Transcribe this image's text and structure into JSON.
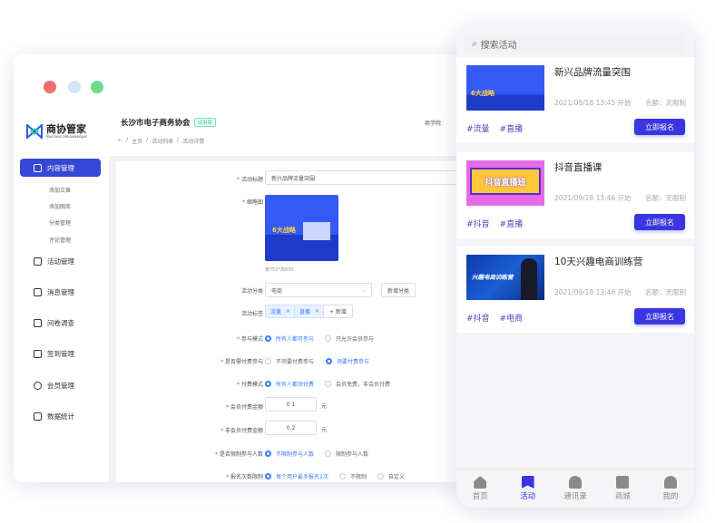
{
  "colors": {
    "accent": "#3547d6",
    "mobile_accent": "#3a36e0",
    "radio_active": "#3a7afe",
    "traffic": [
      "#f26d6d",
      "#d5e3fb",
      "#6fdc8c"
    ]
  },
  "brand": {
    "name": "商协管家",
    "subtitle": "Business Housekeeper"
  },
  "sidebar": {
    "active": {
      "label": "内容管理",
      "icon": "edit-icon"
    },
    "sub_items": [
      "添加文章",
      "添加图库",
      "分类管理",
      "评论管理"
    ],
    "items": [
      {
        "label": "活动管理",
        "icon": "flag-icon"
      },
      {
        "label": "消息管理",
        "icon": "message-icon"
      },
      {
        "label": "问卷调查",
        "icon": "book-icon"
      },
      {
        "label": "签到管理",
        "icon": "calendar-check-icon"
      },
      {
        "label": "会员管理",
        "icon": "users-icon"
      },
      {
        "label": "数据统计",
        "icon": "chart-icon"
      }
    ]
  },
  "header": {
    "org": "长沙市电子商务协会",
    "badge": "试用版",
    "right_link": "商学院",
    "breadcrumb": [
      "主页",
      "活动列表",
      "活动详情"
    ]
  },
  "form": {
    "title_label": "活动标题",
    "title_value": "新兴品牌流量突围",
    "thumb_label": "缩略图",
    "thumb_hint": "宽750*高600",
    "category_label": "活动分类",
    "category_value": "电商",
    "add_category": "新增分类",
    "tags_label": "活动标签",
    "tags": [
      "流量",
      "直播"
    ],
    "add_tag": "+ 新增",
    "radios": [
      {
        "label": "参与模式",
        "options": [
          "所有人都可参与",
          "只允许会员参与"
        ],
        "selected": 0
      },
      {
        "label": "是否需付费参与",
        "options": [
          "不须要付费参与",
          "须要付费参与"
        ],
        "selected": 1
      },
      {
        "label": "付费模式",
        "options": [
          "所有人都须付费",
          "会员免费，非会员付费"
        ],
        "selected": 0
      }
    ],
    "member_fee_label": "会员付费金额",
    "member_fee": "0.1",
    "nonmember_fee_label": "非会员付费金额",
    "nonmember_fee": "0.2",
    "unit": "元",
    "radios2": [
      {
        "label": "是否限制参与人数",
        "options": [
          "不限制参与人数",
          "限制参与人数"
        ],
        "selected": 0
      },
      {
        "label": "报名次数限制",
        "options": [
          "每个用户最多报名1次",
          "不限制",
          "自定义"
        ],
        "selected": 0
      }
    ]
  },
  "mobile": {
    "search_placeholder": "搜索活动",
    "activities": [
      {
        "title": "新兴品牌流量突围",
        "date": "2021/09/18 13:45 开始",
        "quota": "名额：无限制",
        "tags": [
          "#流量",
          "#直播"
        ],
        "button": "立即报名"
      },
      {
        "title": "抖音直播课",
        "date": "2021/09/18 13:46 开始",
        "quota": "名额：无限制",
        "tags": [
          "#抖音",
          "#直播"
        ],
        "button": "立即报名"
      },
      {
        "title": "10天兴趣电商训练营",
        "date": "2021/09/18 13:46 开始",
        "quota": "名额：无限制",
        "tags": [
          "#抖音",
          "#电商"
        ],
        "button": "立即报名"
      }
    ],
    "thumb_texts": [
      "6大战略",
      "抖音直播班",
      "兴趣电商训练营"
    ],
    "tabs": [
      {
        "label": "首页",
        "icon": "home-icon"
      },
      {
        "label": "活动",
        "icon": "activity-icon",
        "active": true
      },
      {
        "label": "通讯录",
        "icon": "contacts-icon"
      },
      {
        "label": "商城",
        "icon": "shop-icon"
      },
      {
        "label": "我的",
        "icon": "user-icon"
      }
    ]
  }
}
